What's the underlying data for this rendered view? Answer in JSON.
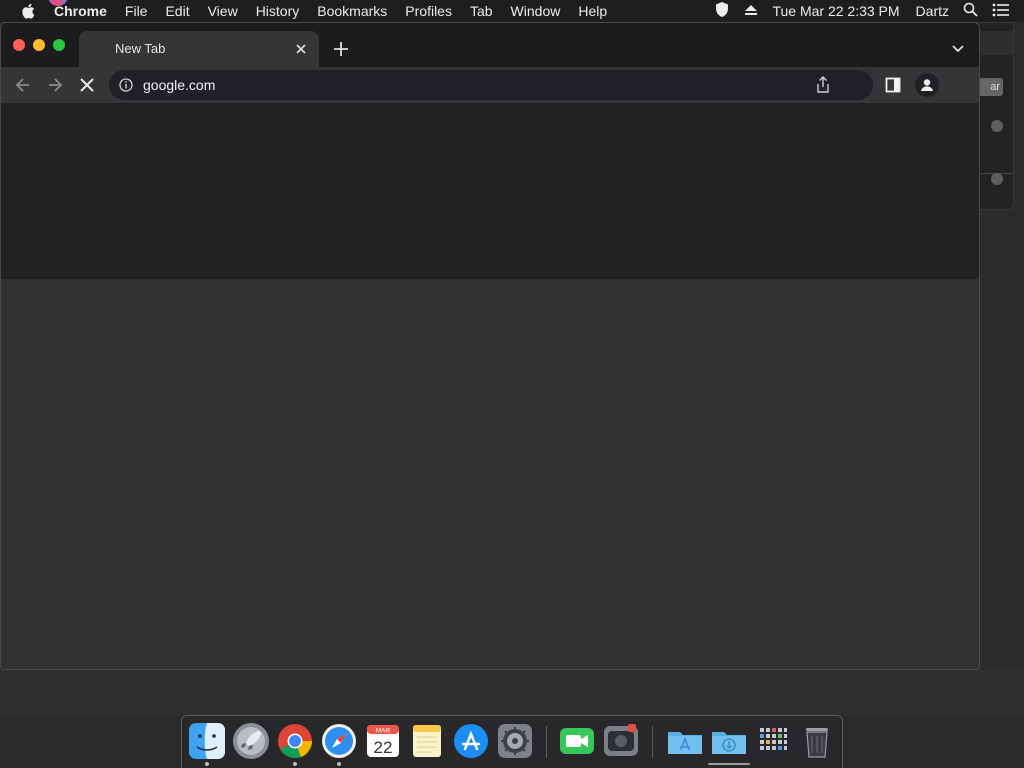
{
  "menubar": {
    "app_name": "Chrome",
    "items": [
      "File",
      "Edit",
      "View",
      "History",
      "Bookmarks",
      "Profiles",
      "Tab",
      "Window",
      "Help"
    ],
    "clock": "Tue Mar 22  2:33 PM",
    "user": "Dartz"
  },
  "browser": {
    "tab_title": "New Tab",
    "url": "google.com",
    "state": "loading"
  },
  "background_window": {
    "button_partial_label": "ar"
  },
  "dock": {
    "items": [
      {
        "name": "finder-icon",
        "running": true
      },
      {
        "name": "launchpad-icon",
        "running": false
      },
      {
        "name": "chrome-icon",
        "running": true
      },
      {
        "name": "safari-icon",
        "running": true
      },
      {
        "name": "calendar-icon",
        "running": false,
        "month": "MAR",
        "day": "22"
      },
      {
        "name": "notes-icon",
        "running": false
      },
      {
        "name": "app-store-icon",
        "running": false
      },
      {
        "name": "system-preferences-icon",
        "running": false
      },
      {
        "name": "facetime-icon",
        "running": false
      },
      {
        "name": "photo-booth-icon",
        "running": false
      },
      {
        "name": "applications-folder-icon",
        "running": false
      },
      {
        "name": "downloads-folder-icon",
        "running": false
      },
      {
        "name": "launchpad-grid-icon",
        "running": false
      },
      {
        "name": "trash-icon",
        "running": false
      }
    ]
  },
  "colors": {
    "close": "#fe5f57",
    "minimize": "#febc2e",
    "maximize": "#28c840",
    "omnibox_bg": "#202124",
    "toolbar_bg": "#353537"
  }
}
